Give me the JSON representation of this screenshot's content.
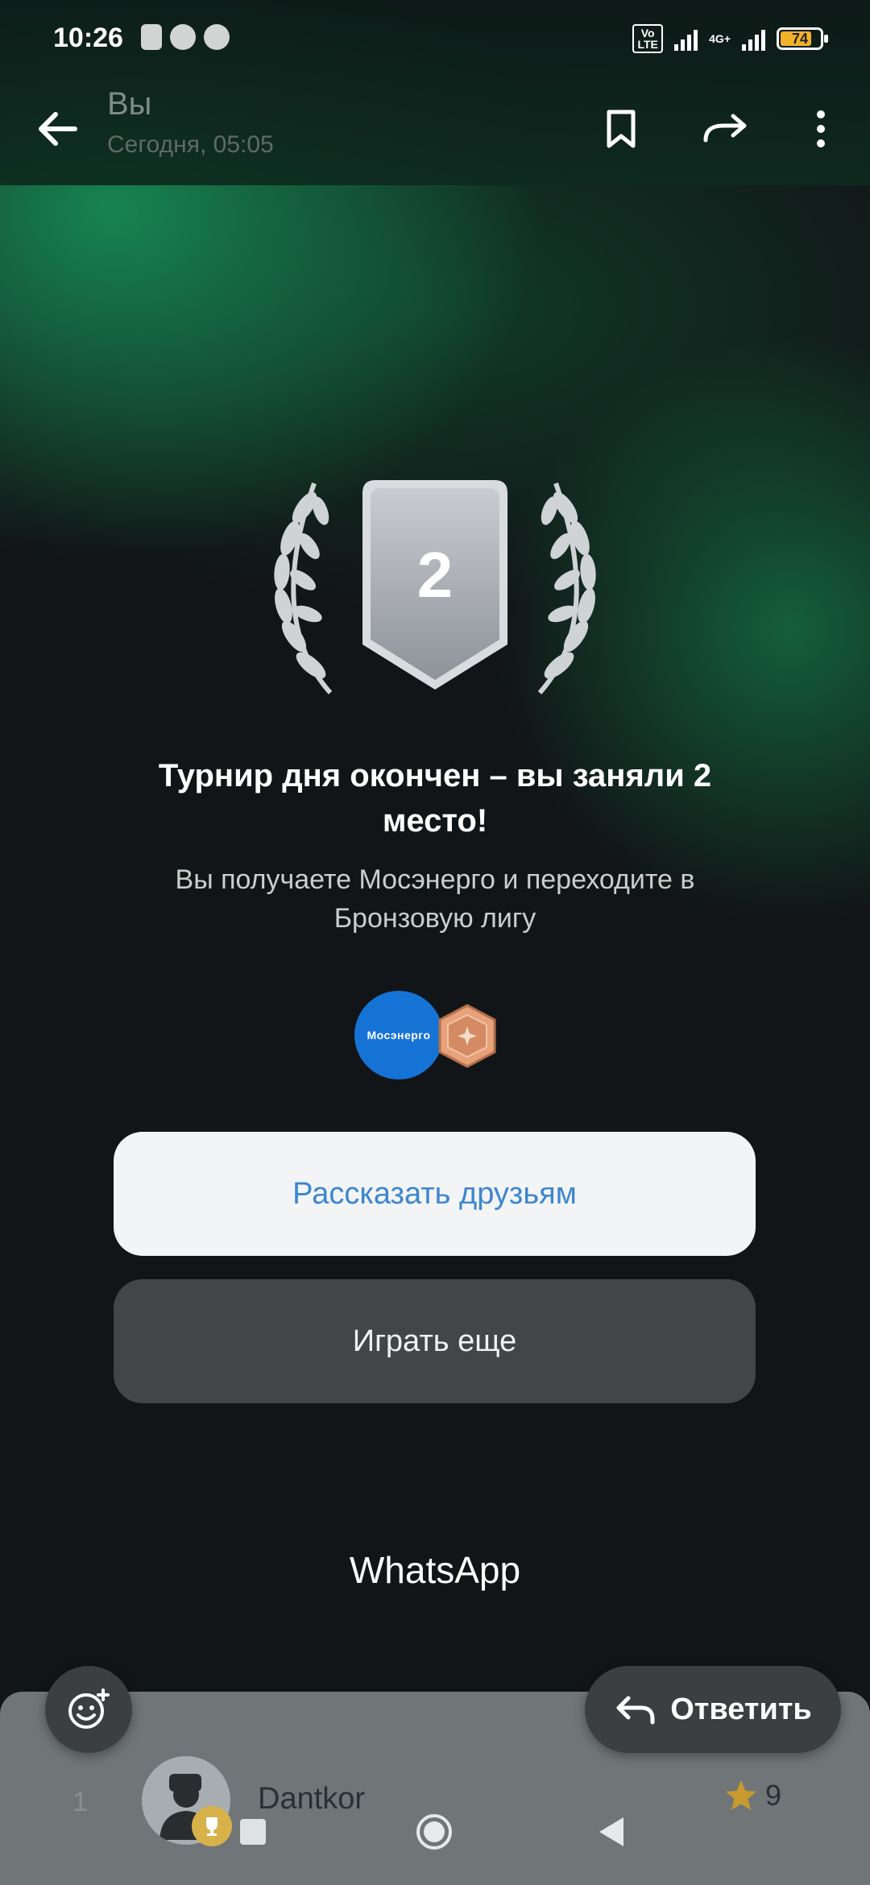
{
  "status_bar": {
    "time": "10:26",
    "volte": "Vo LTE",
    "network": "4G+",
    "battery": "74"
  },
  "header": {
    "title": "Вы",
    "subtitle": "Сегодня, 05:05",
    "icons": [
      "back-arrow-icon",
      "bookmark-icon",
      "forward-icon",
      "more-vert-icon"
    ]
  },
  "result": {
    "place": "2",
    "headline": "Турнир дня окончен – вы заняли 2 место!",
    "description": "Вы получаете Мосэнерго и переходите в Бронзовую лигу",
    "brand_logo_text": "Мосэнерго"
  },
  "buttons": {
    "share": "Рассказать друзьям",
    "play_again": "Играть еще"
  },
  "footer": {
    "app_name": "WhatsApp",
    "reply": "Ответить"
  },
  "leaderboard_row": {
    "rank": "1",
    "username": "Dantkor",
    "score": "9"
  },
  "colors": {
    "accent_blue": "#3d86cf",
    "green_glow": "#18965a",
    "bronze": "#d99066"
  }
}
